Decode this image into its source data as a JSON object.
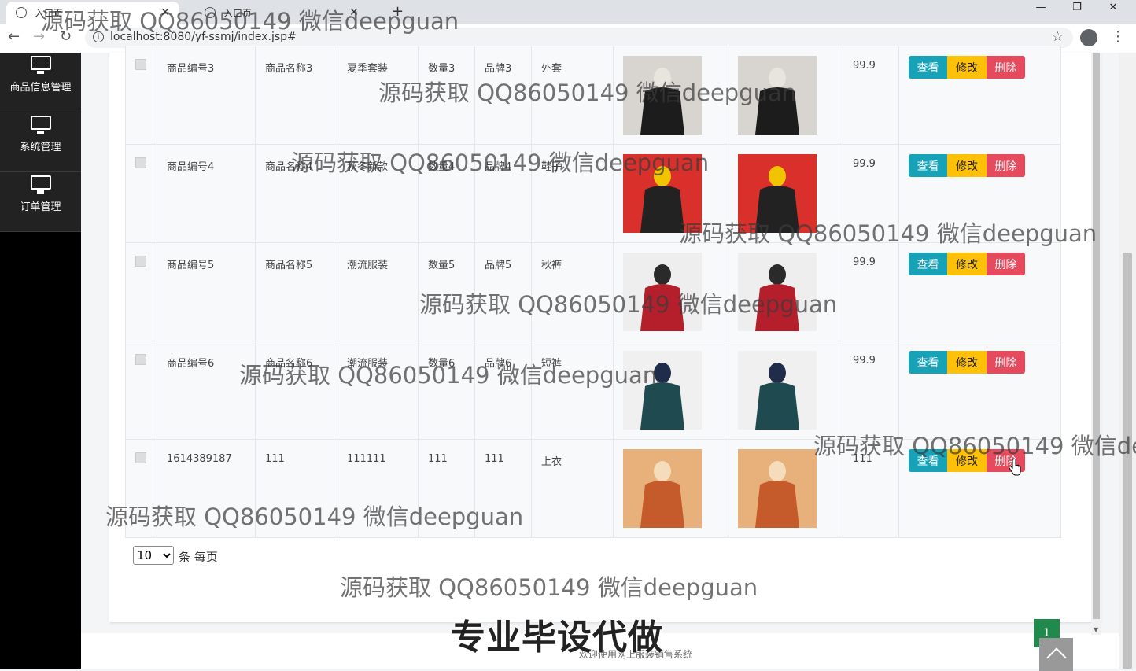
{
  "browser": {
    "tabs": [
      {
        "title": "入口页",
        "active": true
      },
      {
        "title": "入口页",
        "active": false
      }
    ],
    "url": "localhost:8080/yf-ssmj/index.jsp#",
    "window_controls": [
      "—",
      "❐",
      "✕"
    ]
  },
  "sidebar": {
    "items": [
      {
        "label": "商品信息管理",
        "icon": "monitor-icon"
      },
      {
        "label": "系统管理",
        "icon": "monitor-icon"
      },
      {
        "label": "订单管理",
        "icon": "monitor-icon"
      }
    ]
  },
  "table": {
    "rows": [
      {
        "code": "商品编号3",
        "name": "商品名称3",
        "category": "夏季套装",
        "quantity": "数量3",
        "brand": "品牌3",
        "type": "外套",
        "images": [
          "woman-black-coat",
          "woman-black-coat"
        ],
        "price": "99.9"
      },
      {
        "code": "商品编号4",
        "name": "商品名称4",
        "category": "秋冬新款",
        "quantity": "数量4",
        "brand": "品牌4",
        "type": "鞋子",
        "images": [
          "tweed-jacket-promo",
          "tweed-jacket-promo"
        ],
        "price": "99.9"
      },
      {
        "code": "商品编号5",
        "name": "商品名称5",
        "category": "潮流服装",
        "quantity": "数量5",
        "brand": "品牌5",
        "type": "秋裤",
        "images": [
          "red-suit-models",
          "red-suit-models"
        ],
        "price": "99.9"
      },
      {
        "code": "商品编号6",
        "name": "商品名称6",
        "category": "潮流服装",
        "quantity": "数量6",
        "brand": "品牌6",
        "type": "短裤",
        "images": [
          "green-suit-models",
          "green-suit-models"
        ],
        "price": "99.9"
      },
      {
        "code": "1614389187",
        "name": "111",
        "category": "111111",
        "quantity": "111",
        "brand": "111",
        "type": "上衣",
        "images": [
          "brand-banner",
          "brand-banner"
        ],
        "price": "111"
      }
    ],
    "actions": {
      "view": "查看",
      "edit": "修改",
      "delete": "删除"
    }
  },
  "pagination": {
    "page_size": "10",
    "page_size_options": [
      "10"
    ],
    "page_size_label": "条 每页",
    "current_page": "1"
  },
  "footer": {
    "text": "欢迎使用网上服装销售系统"
  },
  "watermarks": {
    "text": "源码获取 QQ86050149 微信deepguan",
    "bottom": "专业毕设代做"
  },
  "colors": {
    "view": "#17a2b8",
    "edit": "#ffc107",
    "delete": "#e64a5d",
    "page": "#1f8a4c"
  }
}
